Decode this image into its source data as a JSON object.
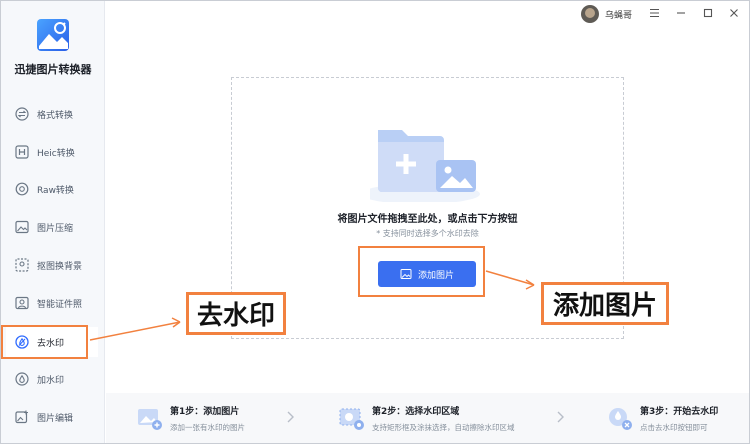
{
  "app": {
    "title": "迅捷图片转换器"
  },
  "titlebar": {
    "username": "乌蝇哥"
  },
  "sidebar": {
    "items": [
      {
        "label": "格式转换",
        "icon": "swap-icon"
      },
      {
        "label": "Heic转换",
        "icon": "heic-icon"
      },
      {
        "label": "Raw转换",
        "icon": "camera-icon"
      },
      {
        "label": "图片压缩",
        "icon": "image-icon"
      },
      {
        "label": "抠图换背景",
        "icon": "crop-icon"
      },
      {
        "label": "智能证件照",
        "icon": "id-photo-icon"
      },
      {
        "label": "去水印",
        "icon": "remove-watermark-icon",
        "active": true
      },
      {
        "label": "加水印",
        "icon": "droplet-icon"
      },
      {
        "label": "图片编辑",
        "icon": "edit-image-icon"
      }
    ]
  },
  "main": {
    "drop_text": "将图片文件拖拽至此处，或点击下方按钮",
    "drop_hint": "* 支持同时选择多个水印去除",
    "add_button": "添加图片"
  },
  "annotations": {
    "left_label": "去水印",
    "right_label": "添加图片"
  },
  "steps": [
    {
      "title": "第1步：添加图片",
      "desc": "添加一张有水印的图片"
    },
    {
      "title": "第2步：选择水印区域",
      "desc": "支持矩形框及涂抹选择，自动擦除水印区域"
    },
    {
      "title": "第3步：开始去水印",
      "desc": "点击去水印按钮即可"
    }
  ],
  "colors": {
    "accent": "#3a6ff0",
    "annotation": "#f2813f",
    "sidebar_bg": "#f6f8fb"
  }
}
